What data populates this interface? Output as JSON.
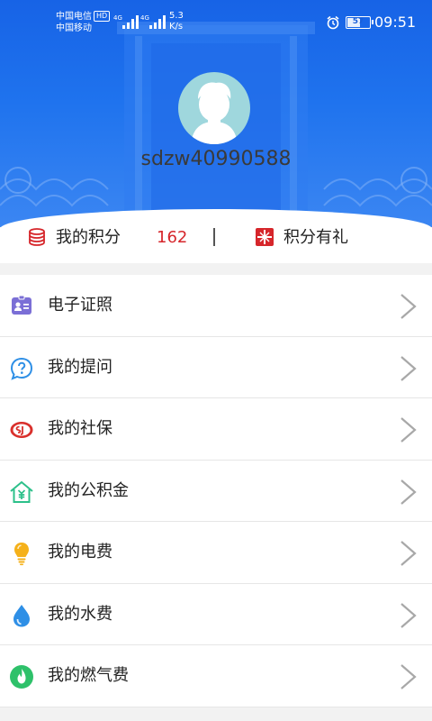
{
  "status_bar": {
    "carrier_1": "中国电信",
    "carrier_1_badge": "HD",
    "carrier_2": "中国移动",
    "net_type_1": "4G",
    "net_type_2": "4G",
    "net_speed_value": "5.3",
    "net_speed_unit": "K/s",
    "battery": "57",
    "battery_level_percent": 57,
    "time": "09:51"
  },
  "profile": {
    "username": "sdzw40990588"
  },
  "points_bar": {
    "points_label": "我的积分",
    "points_value": "162",
    "gift_label": "积分有礼"
  },
  "menu": {
    "items": [
      {
        "label": "电子证照",
        "icon": "id-card-icon",
        "color": "#7b6fd6"
      },
      {
        "label": "我的提问",
        "icon": "question-bubble-icon",
        "color": "#2e8fe6"
      },
      {
        "label": "我的社保",
        "icon": "social-security-icon",
        "color": "#d9302c"
      },
      {
        "label": "我的公积金",
        "icon": "housing-fund-icon",
        "color": "#2cc08a"
      },
      {
        "label": "我的电费",
        "icon": "lightbulb-icon",
        "color": "#f5b11a"
      },
      {
        "label": "我的水费",
        "icon": "water-drop-icon",
        "color": "#2e8fe6"
      },
      {
        "label": "我的燃气费",
        "icon": "gas-flame-icon",
        "color": "#2ec16a"
      }
    ]
  },
  "colors": {
    "header_blue": "#1f73ee",
    "points_red": "#d6262b"
  }
}
